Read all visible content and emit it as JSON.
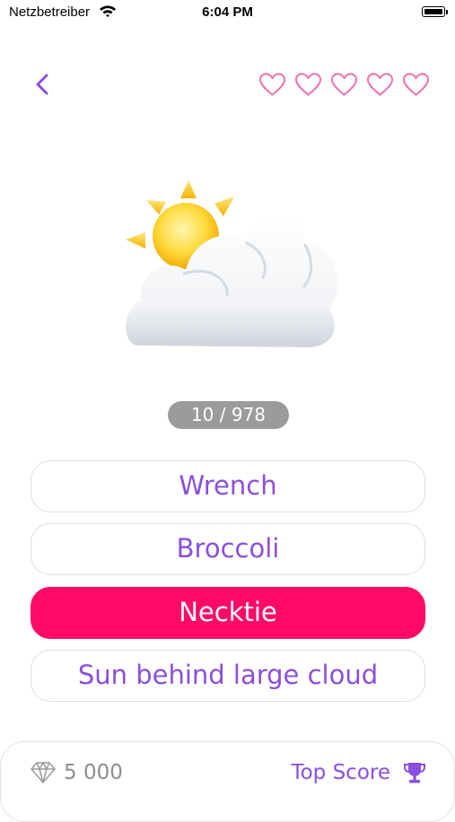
{
  "status_bar": {
    "carrier": "Netzbetreiber",
    "time": "6:04 PM"
  },
  "header": {
    "lives": 5,
    "heart_color": "#ef6fb0"
  },
  "question": {
    "emoji": "sun-behind-large-cloud",
    "progress": "10 / 978"
  },
  "answers": [
    {
      "label": "Wrench",
      "selected": false
    },
    {
      "label": "Broccoli",
      "selected": false
    },
    {
      "label": "Necktie",
      "selected": true
    },
    {
      "label": "Sun behind large cloud",
      "selected": false
    }
  ],
  "footer": {
    "gems": "5 000",
    "top_score_label": "Top Score"
  },
  "colors": {
    "accent": "#8a4fe0",
    "selected": "#ff0a67",
    "pill": "#9b9b9b"
  }
}
